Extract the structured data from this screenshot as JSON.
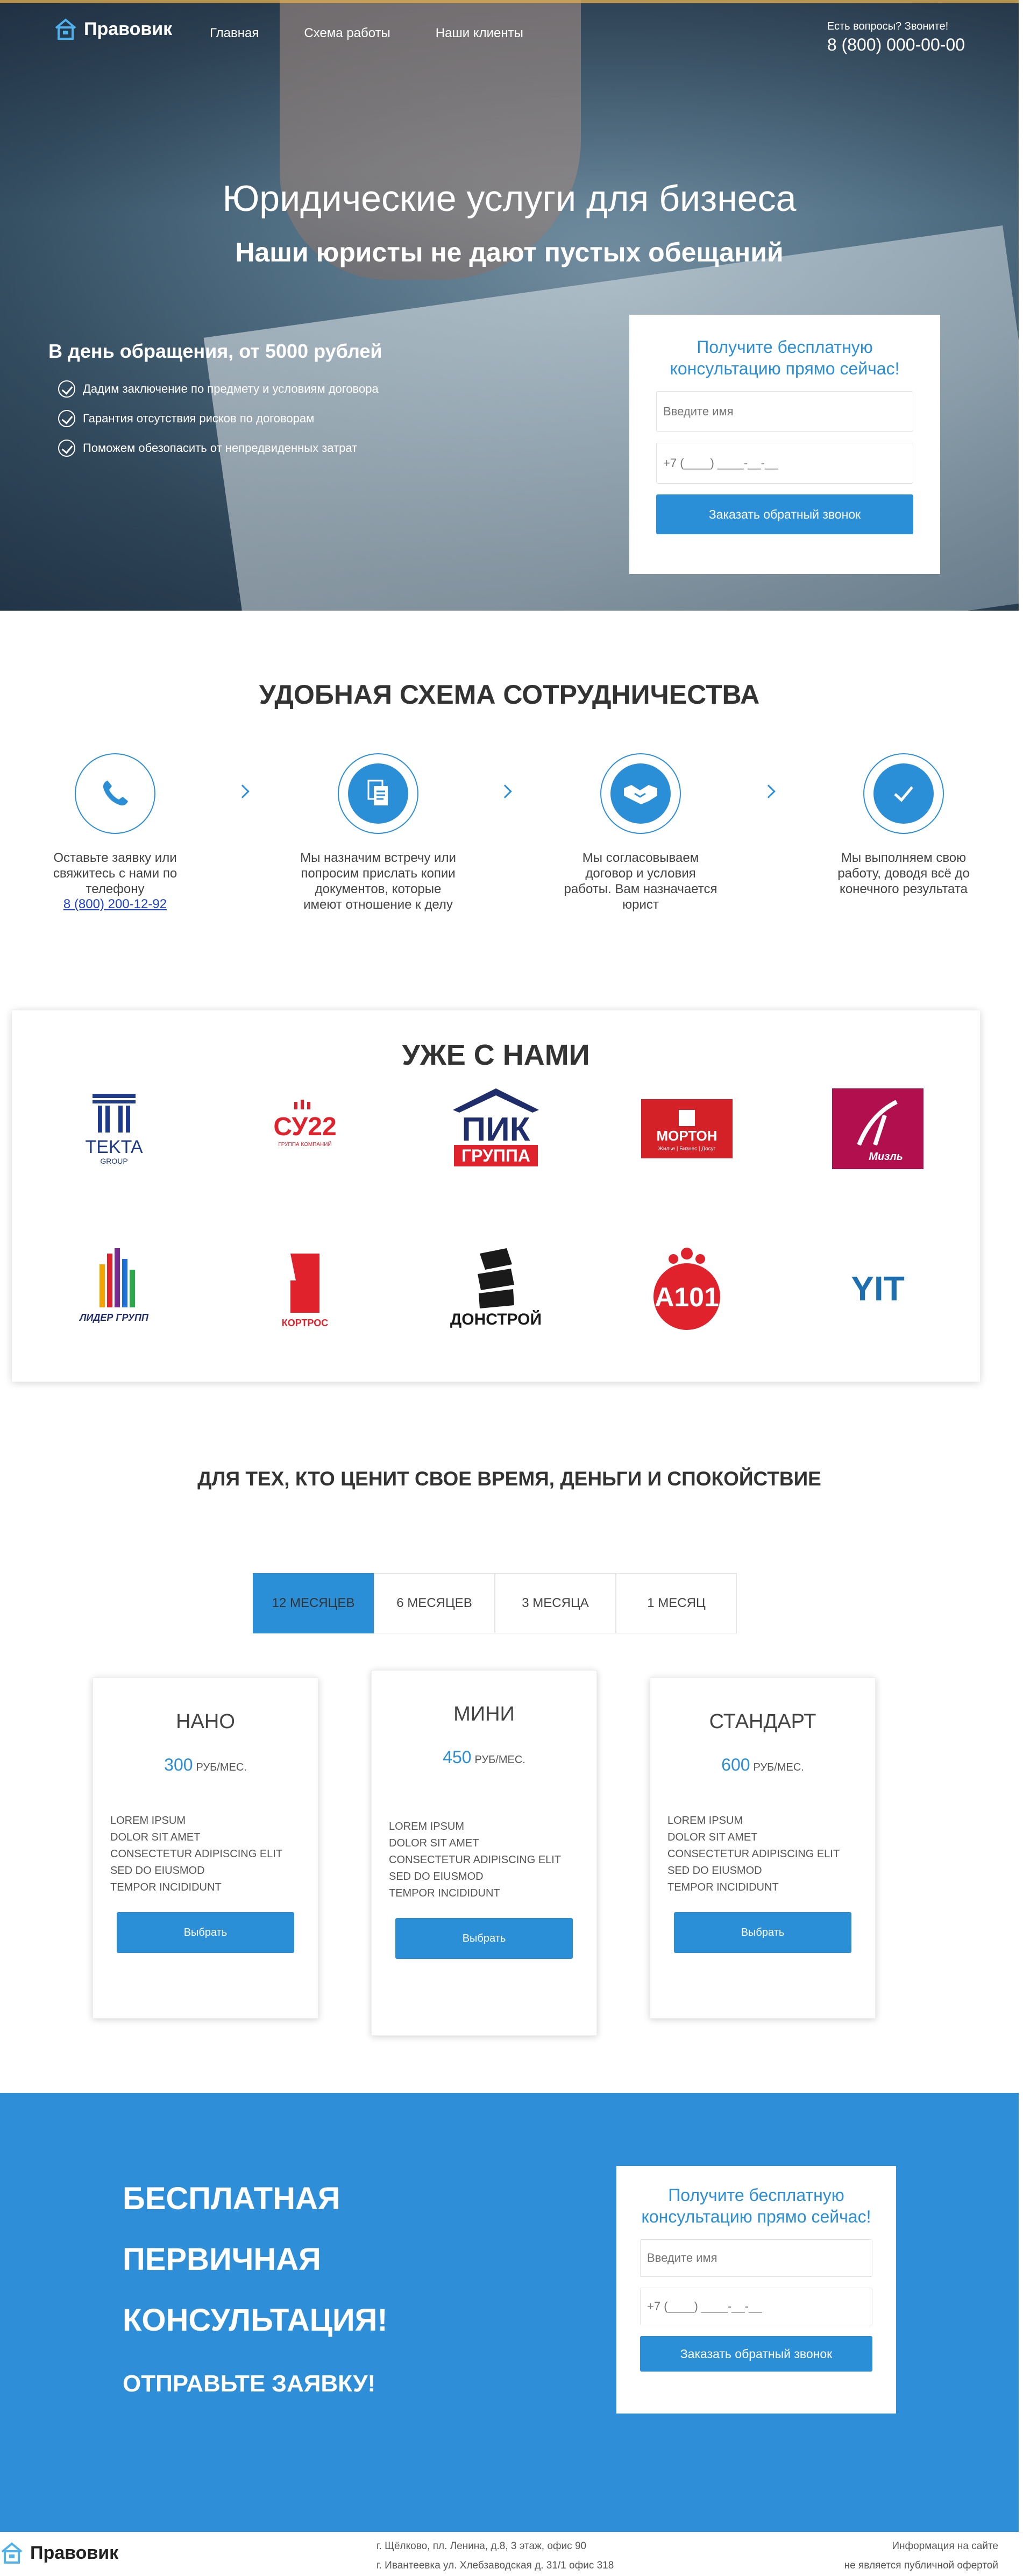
{
  "header": {
    "logo_text": "Правовик",
    "nav": [
      "Главная",
      "Схема работы",
      "Наши клиенты"
    ],
    "contact_question": "Есть вопросы? Звоните!",
    "contact_phone": "8 (800) 000-00-00"
  },
  "hero": {
    "title": "Юридические услуги для бизнеса",
    "subtitle": "Наши юристы не дают пустых обещаний",
    "price_line": "В день обращения, от 5000 рублей",
    "bullets": [
      "Дадим заключение по предмету и условиям договора",
      "Гарантия отсутствия рисков по договорам",
      "Поможем обезопасить от непредвиденных затрат"
    ]
  },
  "callback_form": {
    "title": "Получите бесплатную консультацию прямо сейчас!",
    "name_placeholder": "Введите имя",
    "phone_placeholder": "+7 (____) ____-__-__",
    "button": "Заказать обратный звонок"
  },
  "scheme": {
    "title": "УДОБНАЯ СХЕМА СОТРУДНИЧЕСТВА",
    "steps": [
      {
        "text": "Оставьте заявку или свяжитесь с нами по телефону",
        "phone": "8 (800) 200-12-92",
        "icon": "phone-icon"
      },
      {
        "text": "Мы назначим встречу или попросим прислать копии документов, которые имеют отношение к делу",
        "icon": "documents-icon"
      },
      {
        "text": "Мы согласовываем договор и условия работы. Вам назначается юрист",
        "icon": "handshake-icon"
      },
      {
        "text": "Мы выполняем свою работу, доводя всё до конечного результата",
        "icon": "check-icon"
      }
    ]
  },
  "clients": {
    "title": "УЖЕ С НАМИ",
    "logos": [
      {
        "name": "TEKTA",
        "sub": "GROUP"
      },
      {
        "name": "СУ22",
        "sub": "ГРУППА КОМПАНИЙ"
      },
      {
        "name": "ПИК",
        "sub": "ГРУППА"
      },
      {
        "name": "МОРТОН",
        "sub": "Жилье | Бизнес | Досуг"
      },
      {
        "name": "Мизль",
        "sub": ""
      },
      {
        "name": "ЛИДЕР ГРУПП",
        "sub": ""
      },
      {
        "name": "КОРТРОС",
        "sub": ""
      },
      {
        "name": "ДОНСТРОЙ",
        "sub": ""
      },
      {
        "name": "А101",
        "sub": ""
      },
      {
        "name": "YIT",
        "sub": ""
      }
    ]
  },
  "pricing": {
    "title": "ДЛЯ ТЕХ, КТО ЦЕНИТ СВОЕ ВРЕМЯ, ДЕНЬГИ И СПОКОЙСТВИЕ",
    "tabs": [
      "12 МЕСЯЦЕВ",
      "6 МЕСЯЦЕВ",
      "3 МЕСЯЦА",
      "1 МЕСЯЦ"
    ],
    "active_tab": 0,
    "plans": [
      {
        "name": "НАНО",
        "price": "300",
        "unit": "РУБ/МЕС.",
        "features": [
          "LOREM IPSUM",
          "DOLOR SIT AMET",
          "CONSECTETUR ADIPISCING ELIT",
          "SED DO EIUSMOD",
          "TEMPOR INCIDIDUNT"
        ],
        "button": "Выбрать"
      },
      {
        "name": "МИНИ",
        "price": "450",
        "unit": "РУБ/МЕС.",
        "features": [
          "LOREM IPSUM",
          "DOLOR SIT AMET",
          "CONSECTETUR ADIPISCING ELIT",
          "SED DO EIUSMOD",
          "TEMPOR INCIDIDUNT"
        ],
        "button": "Выбрать"
      },
      {
        "name": "СТАНДАРТ",
        "price": "600",
        "unit": "РУБ/МЕС.",
        "features": [
          "LOREM IPSUM",
          "DOLOR SIT AMET",
          "CONSECTETUR ADIPISCING ELIT",
          "SED DO EIUSMOD",
          "TEMPOR INCIDIDUNT"
        ],
        "button": "Выбрать"
      }
    ]
  },
  "cta": {
    "lines": [
      "БЕСПЛАТНАЯ",
      "ПЕРВИЧНАЯ",
      "КОНСУЛЬТАЦИЯ!"
    ],
    "send": "ОТПРАВЬТЕ ЗАЯВКУ!"
  },
  "footer": {
    "logo_text": "Правовик",
    "address1": "г. Щёлково, пл. Ленина, д.8, 3 этаж, офис 90",
    "address2": "г. Ивантеевка ул. Хлебзаводская д. 31/1 офис 318",
    "note1": "Информация на сайте",
    "note2": "не является публичной офертой"
  },
  "colors": {
    "accent": "#2b8fd8",
    "cta_bg": "#2e8fd8",
    "link": "#1a3fcf"
  }
}
